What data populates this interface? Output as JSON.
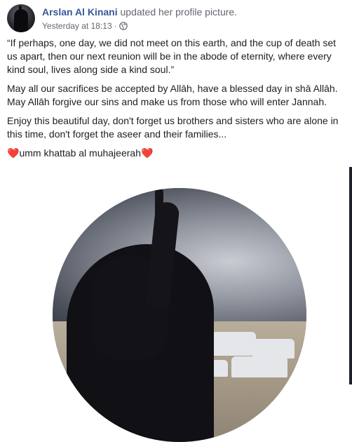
{
  "post": {
    "author": "Arslan Al Kinani",
    "action": "updated her profile picture.",
    "timestamp": "Yesterday at 18:13",
    "separator": "·",
    "privacy_icon": "globe-icon",
    "paragraphs": [
      "“If perhaps, one day, we did not meet on this earth, and the cup of death set us apart, then our next reunion will be in the abode of eternity, where every kind soul, lives along side a kind soul.”",
      "May all our sacrifices be accepted by Allāh, have a blessed day in shā Allāh. May Allāh forgive our sins and make us from those who will enter Jannah.",
      "Enjoy this beautiful day, don't forget us brothers and sisters who are alone in this time, don't forget the aseer and their families..."
    ],
    "signature": {
      "text": "umm khattab al muhajeerah",
      "emoji_left": "❤️",
      "emoji_right": "❤️"
    }
  },
  "colors": {
    "author_link": "#385898",
    "meta_text": "#616770",
    "body_text": "#1c1e21",
    "heart": "#e0245e"
  }
}
